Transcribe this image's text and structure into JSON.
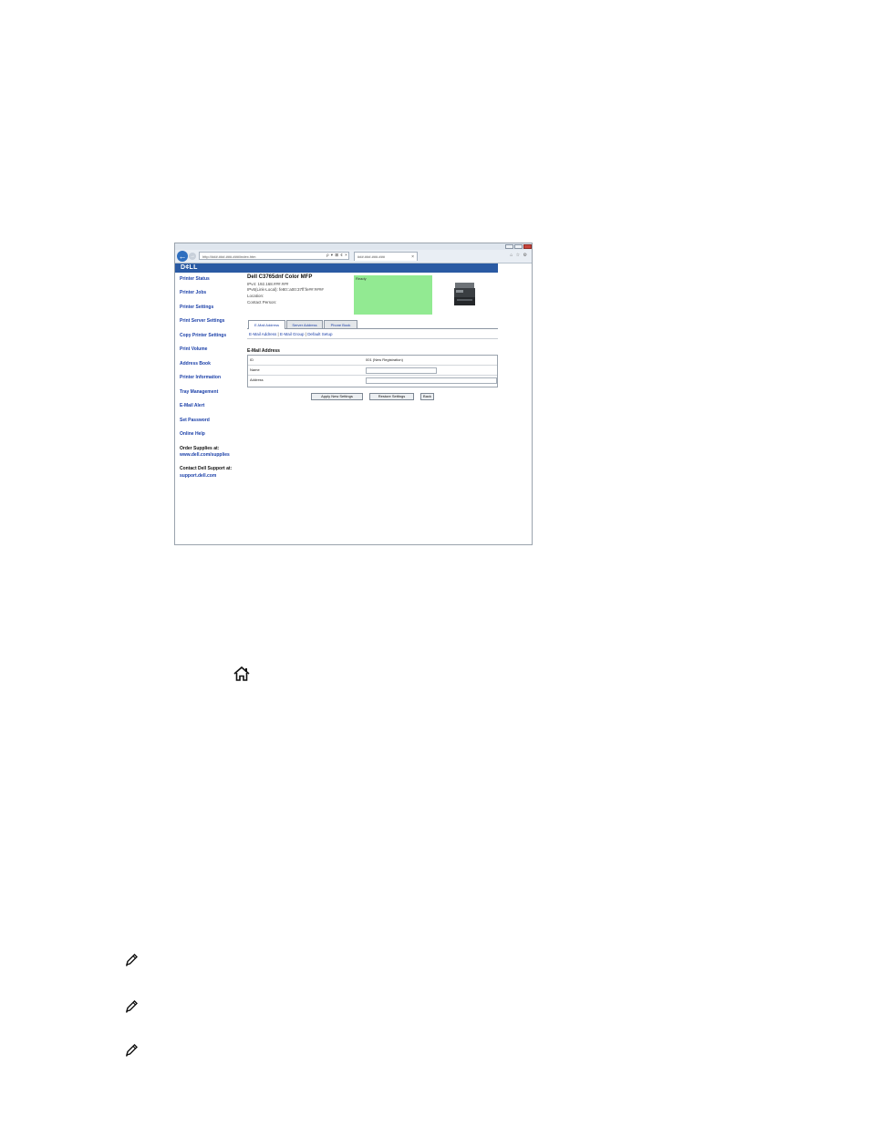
{
  "browser": {
    "address": "http://###.###.###.###/index.htm",
    "tab_title": "###.###.###.###",
    "tab_close": "×",
    "toolbar_glyphs": "ρ ▾ ⊠ ¢ ×",
    "right_icons": "⌂ ☆ ⚙"
  },
  "brand": {
    "logo": "D¢LL"
  },
  "sidebar": {
    "printer_status": "Printer Status",
    "printer_jobs": "Printer Jobs",
    "printer_settings": "Printer Settings",
    "print_server_settings": "Print Server Settings",
    "copy_printer_settings": "Copy Printer Settings",
    "print_volume": "Print Volume",
    "address_book": "Address Book",
    "printer_information": "Printer Information",
    "tray_management": "Tray Management",
    "email_alert": "E-Mail Alert",
    "set_password": "Set Password",
    "online_help": "Online Help",
    "order_supplies_label": "Order Supplies at:",
    "order_supplies_link": "www.dell.com/supplies",
    "contact_support_label": "Contact Dell Support at:",
    "contact_support_link": "support.dell.com"
  },
  "device": {
    "title": "Dell C3765dnf Color MFP",
    "ipv4": "IPv4: 192.168.###.###",
    "ipv6": "IPv6(Link-Local): fe80::a00:37ff:fe##:####",
    "location": "Location:",
    "contact": "Contact Person:",
    "status": "Ready",
    "status_color": "#92ea92"
  },
  "tabs": {
    "email_address": "E-Mail Address",
    "server_address": "Server Address",
    "phone_book": "Phone Book"
  },
  "sublinks": {
    "email_address": "E-Mail Address",
    "email_group": "E-Mail Group",
    "default_setup": "Default Setup",
    "sep": "|"
  },
  "form": {
    "section_title": "E-Mail Address",
    "id_label": "ID",
    "id_value": "001 (New Registration)",
    "name_label": "Name",
    "address_label": "Address"
  },
  "buttons": {
    "apply": "Apply New Settings",
    "restore": "Restore Settings",
    "back": "Back"
  },
  "icons": {
    "home": "home-icon",
    "note": "note-icon"
  }
}
